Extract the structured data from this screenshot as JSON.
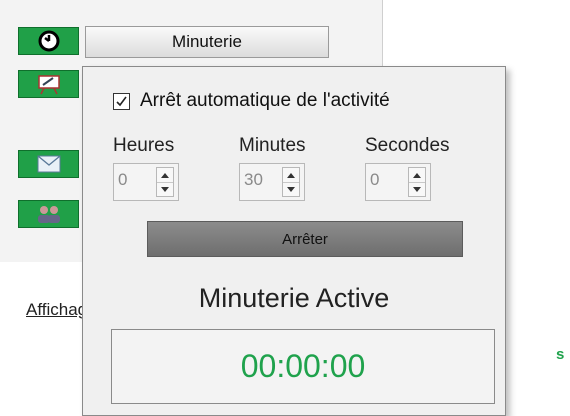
{
  "sidebar": {
    "timer_button_label": "Minuterie",
    "link_label": "Affichage"
  },
  "timer_popup": {
    "auto_stop_label": "Arrêt automatique de l'activité",
    "auto_stop_checked": true,
    "fields": [
      {
        "label": "Heures",
        "value": "0"
      },
      {
        "label": "Minutes",
        "value": "30"
      },
      {
        "label": "Secondes",
        "value": "0"
      }
    ],
    "stop_button_label": "Arrêter",
    "status_title": "Minuterie Active",
    "elapsed_display": "00:00:00"
  },
  "colors": {
    "accent_green": "#20a048",
    "display_text": "#1fa24c"
  },
  "icons": [
    "clock-icon",
    "whiteboard-icon",
    "mail-icon",
    "users-icon",
    "checkmark-icon",
    "spin-up-icon",
    "spin-down-icon"
  ]
}
